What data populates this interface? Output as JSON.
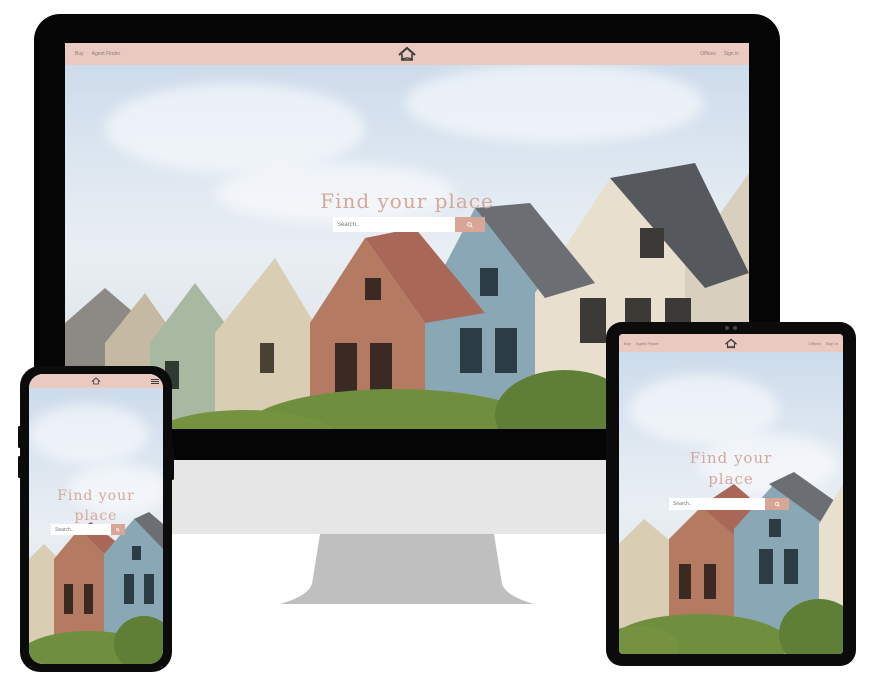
{
  "nav": {
    "left_links": [
      "Buy",
      "Agent Finder"
    ],
    "right_links": [
      "Offices",
      "Sign in"
    ]
  },
  "hero": {
    "title": "Find your place",
    "search_placeholder": "Search.."
  },
  "icons": {
    "logo": "house-logo-icon",
    "search": "search-icon",
    "menu": "hamburger-menu-icon"
  },
  "colors": {
    "navbar": "#e9c9c0",
    "title": "#d6a89b",
    "search_button": "#d9a596"
  }
}
